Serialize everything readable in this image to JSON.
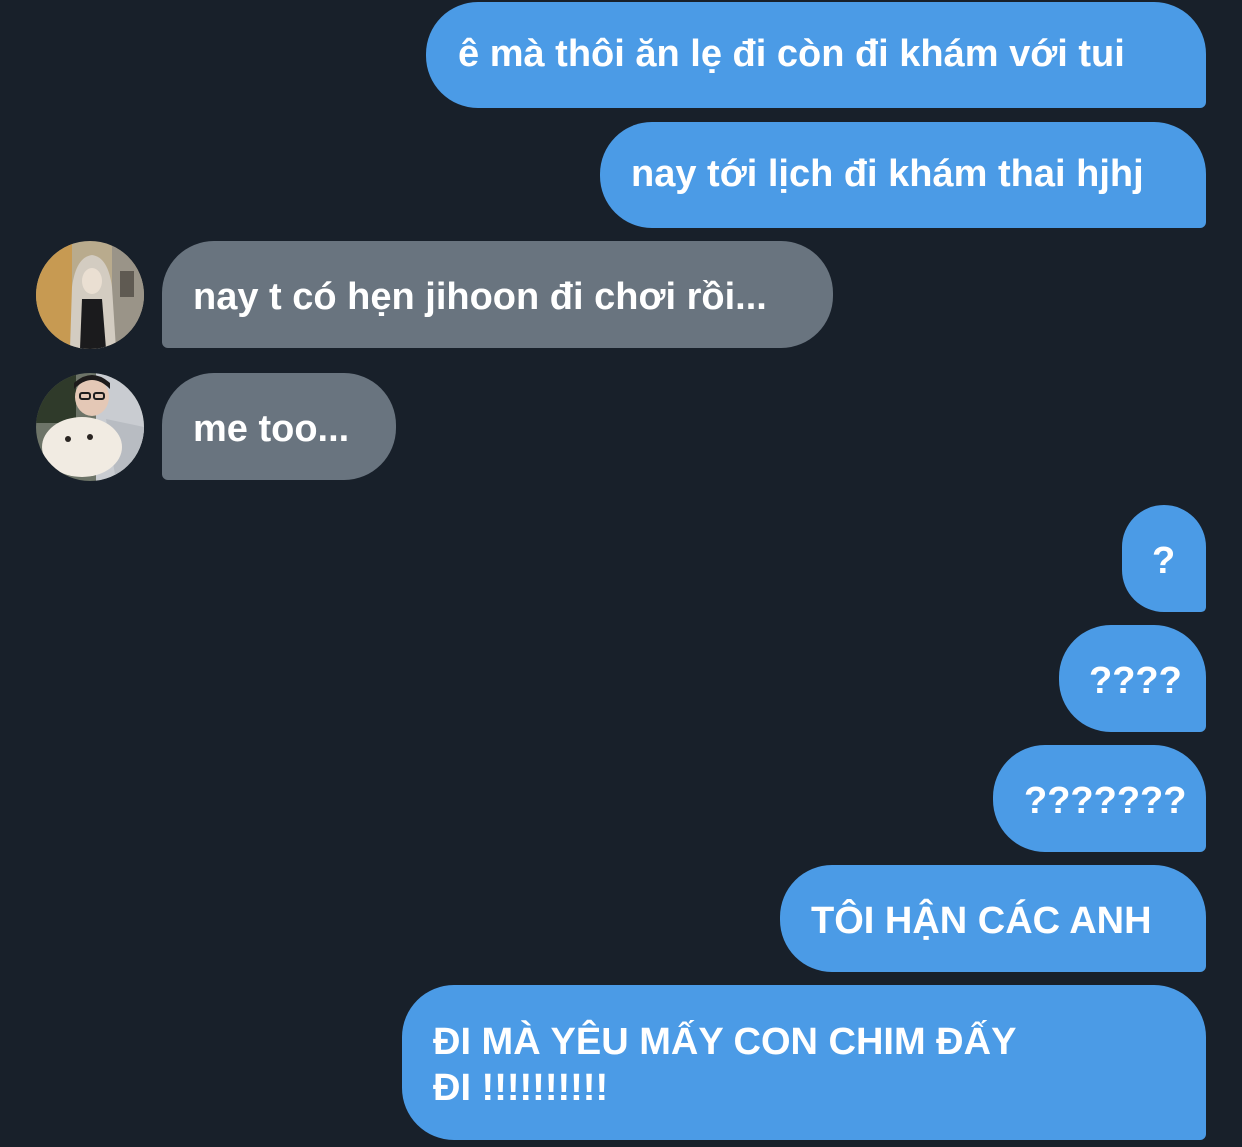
{
  "messages": [
    {
      "side": "out",
      "text": "ê mà thôi ăn lẹ đi còn đi khám với tui"
    },
    {
      "side": "out",
      "text": "nay tới lịch đi khám thai hjhj"
    },
    {
      "side": "in",
      "avatar": "user-avatar-hoodie",
      "text": "nay t có hẹn jihoon đi chơi rồi..."
    },
    {
      "side": "in",
      "avatar": "user-avatar-glasses-dog",
      "text": "me too..."
    },
    {
      "side": "out",
      "text": "?"
    },
    {
      "side": "out",
      "text": "????"
    },
    {
      "side": "out",
      "text": "???????"
    },
    {
      "side": "out",
      "text": "TÔI HẬN CÁC ANH"
    },
    {
      "side": "out",
      "lines": [
        "ĐI MÀ YÊU MẤY CON CHIM ĐẤY",
        "ĐI !!!!!!!!!!"
      ]
    }
  ],
  "colors": {
    "background": "#18202a",
    "outgoing_bubble": "#4b9be6",
    "incoming_bubble": "#69747f",
    "text": "#ffffff"
  }
}
